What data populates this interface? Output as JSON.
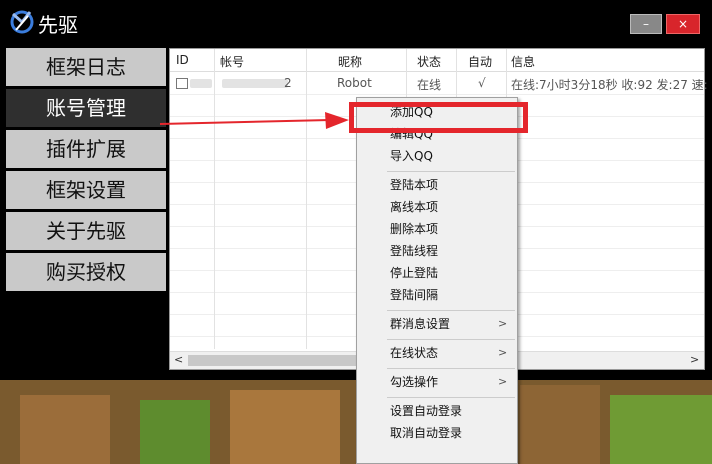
{
  "window": {
    "title": "先驱"
  },
  "window_controls": {
    "minimize": "–",
    "close": "×"
  },
  "sidebar": {
    "items": [
      {
        "label": "框架日志",
        "active": false
      },
      {
        "label": "账号管理",
        "active": true
      },
      {
        "label": "插件扩展",
        "active": false
      },
      {
        "label": "框架设置",
        "active": false
      },
      {
        "label": "关于先驱",
        "active": false
      },
      {
        "label": "购买授权",
        "active": false
      }
    ]
  },
  "table": {
    "columns": [
      "ID",
      "帐号",
      "昵称",
      "状态",
      "自动",
      "信息"
    ],
    "rows": [
      {
        "account_suffix": "2",
        "nickname": "Robot",
        "status": "在线",
        "auto": "√",
        "info": "在线:7小时3分18秒 收:92 发:27 速:"
      }
    ],
    "scroll_left": "<",
    "scroll_right": ">"
  },
  "context_menu": {
    "groups": [
      [
        "添加QQ",
        "编辑QQ",
        "导入QQ"
      ],
      [
        "登陆本项",
        "离线本项",
        "删除本项",
        "登陆线程",
        "停止登陆",
        "登陆间隔"
      ],
      [
        "群消息设置"
      ],
      [
        "在线状态"
      ],
      [
        "勾选操作"
      ],
      [
        "设置自动登录",
        "取消自动登录"
      ]
    ],
    "submenu_glyph": ">",
    "highlighted_item": "添加QQ"
  },
  "colors": {
    "accent_red": "#e4262c",
    "sidebar_active_bg": "#2f2f2f",
    "sidebar_bg": "#c9c9c9"
  }
}
